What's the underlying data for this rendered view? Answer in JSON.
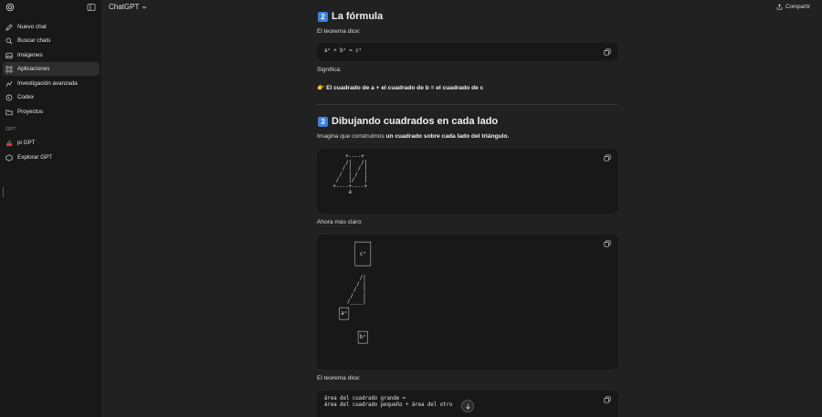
{
  "sidebar": {
    "items": [
      {
        "label": "Nuevo chat",
        "icon": "edit-icon"
      },
      {
        "label": "Buscar chats",
        "icon": "search-icon"
      },
      {
        "label": "Imágenes",
        "icon": "image-icon"
      },
      {
        "label": "Aplicaciones",
        "icon": "apps-icon"
      },
      {
        "label": "Investigación avanzada",
        "icon": "research-icon"
      },
      {
        "label": "Codex",
        "icon": "codex-icon"
      },
      {
        "label": "Proyectos",
        "icon": "folder-icon"
      }
    ],
    "section_label": "GPT",
    "gpts": [
      {
        "label": "pi GPT",
        "icon": "cherry-icon"
      },
      {
        "label": "Explorar GPT",
        "icon": "explore-icon"
      }
    ]
  },
  "header": {
    "model_name": "ChatGPT",
    "share_label": "Compartir"
  },
  "content": {
    "section2": {
      "number": "2",
      "title": "La fórmula"
    },
    "intro1": "El teorema dice:",
    "formula": "a² + b² = c²",
    "meaning_label": "Significa:",
    "meaning": {
      "emoji": "👉",
      "text": "El cuadrado de a + el cuadrado de b = el cuadrado de c"
    },
    "section3": {
      "number": "3",
      "title": "Dibujando cuadrados en cada lado"
    },
    "imagine": {
      "prefix": "Imagina que construimos ",
      "bold": "un cuadrado sobre cada lado del triángulo."
    },
    "diagram1": "     +----+\n     /|   /|\n    / |  / |\n   /  | /  |\n  /   |/   |\n +----+----+\n      a",
    "clearer_label": "Ahora más claro:",
    "diagram2": "       ┌────┐\n       │    │\n       │ c² │\n       │    │\n       └────┘\n\n         /|\n        / |\n       /  |\n      /   |\n     /____|\n  ┌──┐\n  │a²│\n  └──┘\n\n        ┌──┐\n        │b²│\n        └──┘",
    "intro2": "El teorema dice:",
    "final_code": "área del cuadrado grande =\nárea del cuadrado pequeño + área del otro"
  }
}
